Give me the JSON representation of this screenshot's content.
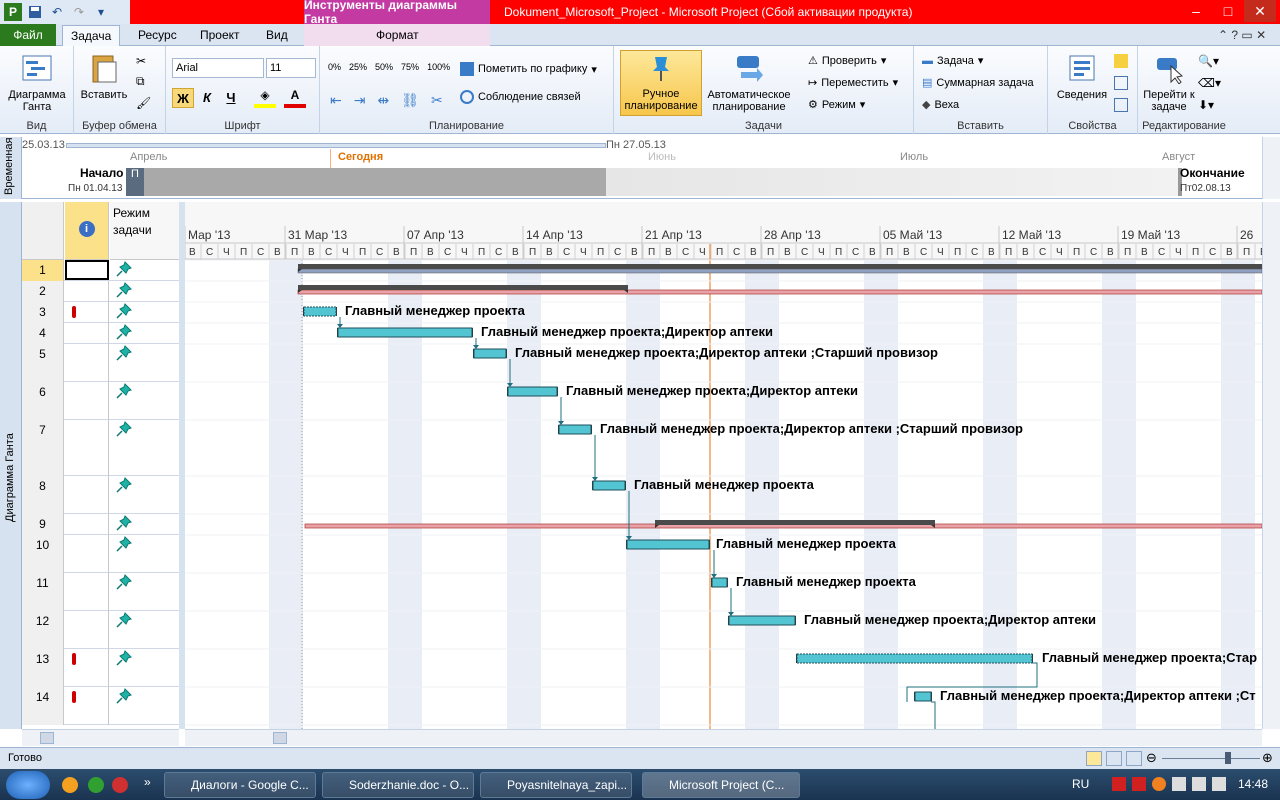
{
  "window": {
    "title": "Dokument_Microsoft_Project  -  Microsoft Project (Сбой активации продукта)",
    "context_group": "Инструменты диаграммы Ганта",
    "minimize": "–",
    "maximize": "□",
    "close": "✕"
  },
  "tabs": {
    "file": "Файл",
    "task": "Задача",
    "resource": "Ресурс",
    "project": "Проект",
    "view": "Вид",
    "format": "Формат"
  },
  "ribbon": {
    "view_group": {
      "label": "Вид",
      "gantt_btn": "Диаграмма Ганта"
    },
    "clipboard": {
      "label": "Буфер обмена",
      "paste": "Вставить"
    },
    "font": {
      "label": "Шрифт",
      "font_name": "Arial",
      "font_size": "11",
      "bold": "Ж",
      "italic": "К",
      "underline": "Ч"
    },
    "schedule": {
      "label": "Планирование",
      "mark": "Пометить по графику",
      "respect": "Соблюдение связей",
      "p0": "0%",
      "p25": "25%",
      "p50": "50%",
      "p75": "75%",
      "p100": "100%"
    },
    "tasks": {
      "label": "Задачи",
      "manual": "Ручное планирование",
      "auto": "Автоматическое планирование",
      "inspect": "Проверить",
      "move": "Переместить",
      "mode": "Режим"
    },
    "insert": {
      "label": "Вставить",
      "task": "Задача",
      "summary": "Суммарная задача",
      "milestone": "Веха"
    },
    "properties": {
      "label": "Свойства",
      "info": "Сведения"
    },
    "editing": {
      "label": "Редактирование",
      "goto": "Перейти к задаче"
    }
  },
  "timeline": {
    "side_label": "Временная",
    "start_date": "25.03.13",
    "mid_date": "Пн 27.05.13",
    "start_label": "Начало",
    "start_value": "Пн 01.04.13",
    "end_label": "Окончание",
    "end_value": "Пт02.08.13",
    "today": "Сегодня",
    "months": [
      "Апрель",
      "Июнь",
      "Июль",
      "Август"
    ],
    "marker": "П"
  },
  "gantt": {
    "side_label": "Диаграмма Ганта",
    "col_mode_header": "Режим задачи",
    "weeks": [
      "Мар '13",
      "31 Мар '13",
      "07 Апр '13",
      "14 Апр '13",
      "21 Апр '13",
      "28 Апр '13",
      "05 Май '13",
      "12 Май '13",
      "19 Май '13",
      "26"
    ],
    "daylabels": [
      "П",
      "В",
      "С",
      "Ч",
      "П",
      "С",
      "В"
    ],
    "rows": [
      {
        "id": "1",
        "label": ""
      },
      {
        "id": "2",
        "label": ""
      },
      {
        "id": "3",
        "label": "Главный менеджер проекта"
      },
      {
        "id": "4",
        "label": "Главный менеджер проекта;Директор аптеки"
      },
      {
        "id": "5",
        "label": "Главный менеджер проекта;Директор аптеки ;Старший провизор"
      },
      {
        "id": "6",
        "label": "Главный менеджер проекта;Директор аптеки"
      },
      {
        "id": "7",
        "label": "Главный менеджер проекта;Директор аптеки ;Старший провизор"
      },
      {
        "id": "8",
        "label": "Главный менеджер проекта"
      },
      {
        "id": "9",
        "label": ""
      },
      {
        "id": "10",
        "label": "Главный менеджер проекта"
      },
      {
        "id": "11",
        "label": "Главный менеджер проекта"
      },
      {
        "id": "12",
        "label": "Главный менеджер проекта;Директор аптеки"
      },
      {
        "id": "13",
        "label": "Главный менеджер проекта;Стар"
      },
      {
        "id": "14",
        "label": "Главный менеджер проекта;Директор аптеки ;Ст"
      }
    ]
  },
  "status": {
    "ready": "Готово"
  },
  "taskbar": {
    "items": [
      "Диалоги - Google C...",
      "Soderzhanie.doc - O...",
      "Poyasnitelnaya_zapi...",
      "Microsoft Project (C..."
    ],
    "lang": "RU",
    "clock": "14:48"
  }
}
